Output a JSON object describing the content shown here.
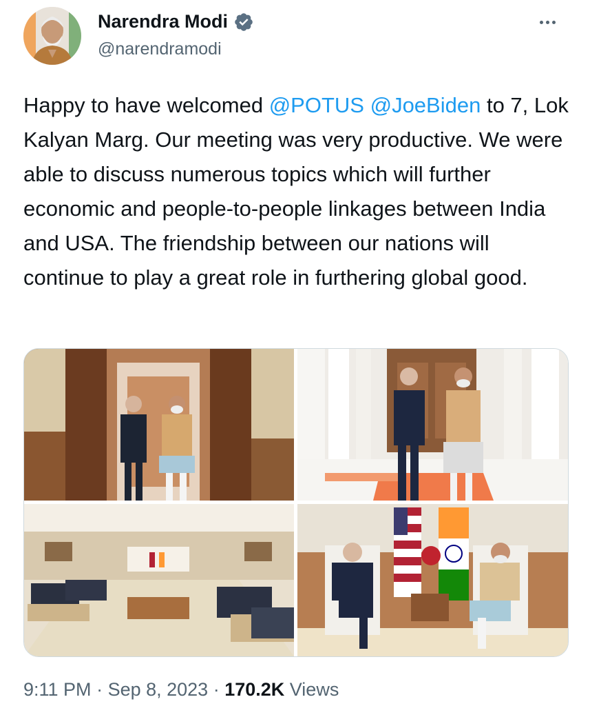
{
  "author": {
    "display_name": "Narendra Modi",
    "handle": "@narendramodi",
    "verified_icon": "verified-badge-icon",
    "verified_color": "#1d9bf0"
  },
  "tweet": {
    "text_before": "Happy to have welcomed ",
    "mention_1": "@POTUS",
    "space": " ",
    "mention_2": "@JoeBiden",
    "text_after": " to 7, Lok Kalyan Marg. Our meeting was very productive. We were able to discuss numerous topics which will further economic and people-to-people linkages between India and USA. The friendship between our nations will continue to play a great role in furthering global good.",
    "mention_color": "#1d9bf0"
  },
  "media": {
    "count": 4,
    "photos": [
      "photo-1",
      "photo-2",
      "photo-3",
      "photo-4"
    ]
  },
  "meta": {
    "time": "9:11 PM",
    "separator_1": " · ",
    "date": "Sep 8, 2023",
    "separator_2": " · ",
    "views_count": "170.2K",
    "views_label": " Views"
  }
}
